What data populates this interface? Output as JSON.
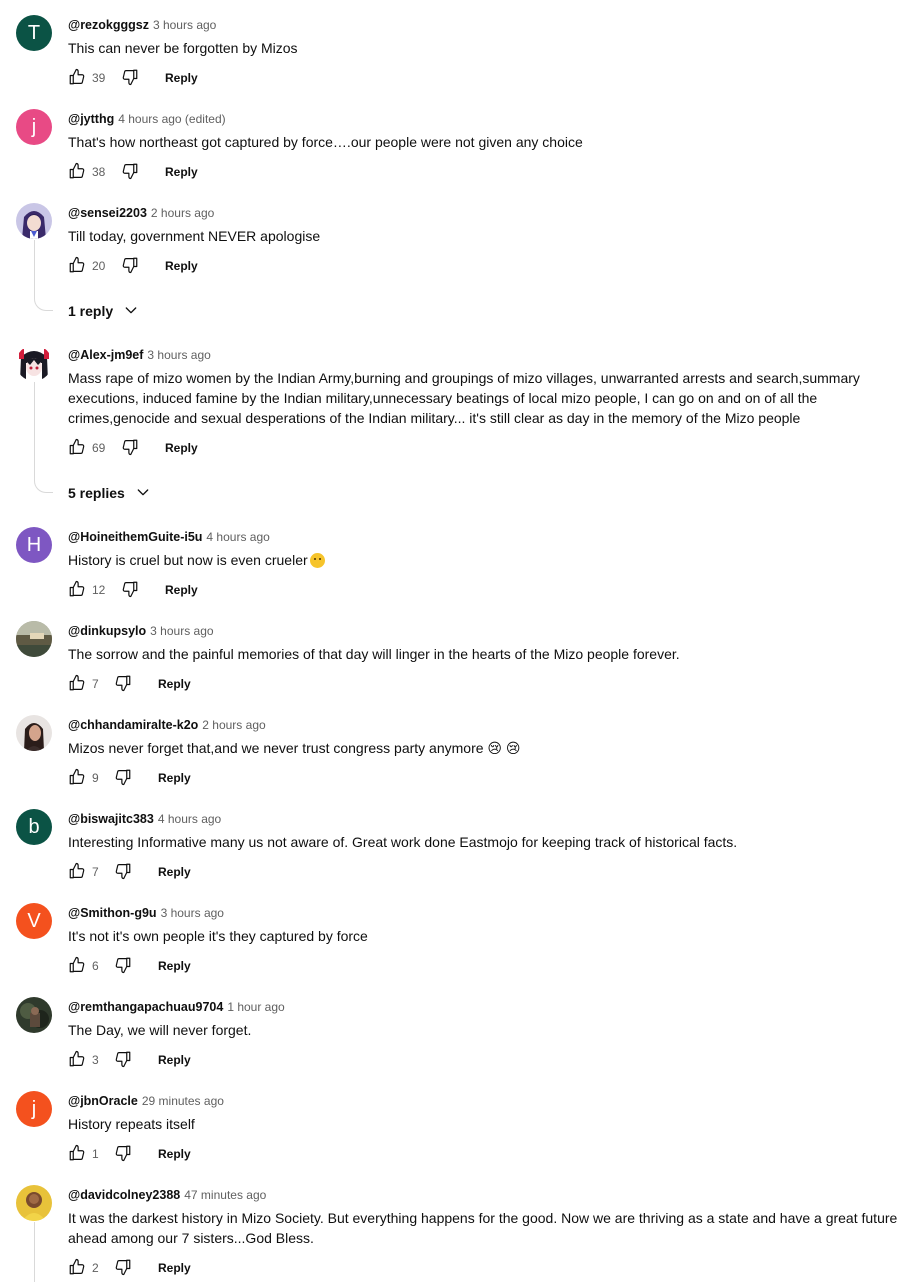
{
  "comments": [
    {
      "author": "@rezokgggsz",
      "time": "3 hours ago",
      "text": "This can never be forgotten by Mizos",
      "likes": "39",
      "reply_label": "Reply",
      "avatar_letter": "T",
      "avatar_color": "#0b5345"
    },
    {
      "author": "@jytthg",
      "time": "4 hours ago (edited)",
      "text": "That's how northeast got captured by force….our people were not given any choice",
      "likes": "38",
      "reply_label": "Reply",
      "avatar_letter": "j",
      "avatar_color": "#e84a85"
    },
    {
      "author": "@sensei2203",
      "time": "2 hours ago",
      "text": "Till today, government NEVER apologise",
      "likes": "20",
      "reply_label": "Reply",
      "replies_label": "1 reply"
    },
    {
      "author": "@Alex-jm9ef",
      "time": "3 hours ago",
      "text": "Mass rape of mizo women by the Indian Army,burning and groupings of mizo villages, unwarranted arrests and search,summary executions, induced famine by the Indian military,unnecessary beatings of local mizo people, I can go on and on of all the crimes,genocide and sexual desperations of the Indian military... it's still clear as day in the memory of the Mizo people",
      "likes": "69",
      "reply_label": "Reply",
      "replies_label": "5 replies"
    },
    {
      "author": "@HoineithemGuite-i5u",
      "time": "4 hours ago",
      "text": "History is cruel but now is even crueler",
      "likes": "12",
      "reply_label": "Reply",
      "avatar_letter": "H",
      "avatar_color": "#7e57c2"
    },
    {
      "author": "@dinkupsylo",
      "time": "3 hours ago",
      "text": "The sorrow and the painful memories of that day will linger in the hearts of the Mizo people forever.",
      "likes": "7",
      "reply_label": "Reply"
    },
    {
      "author": "@chhandamiralte-k2o",
      "time": "2 hours ago",
      "text": "Mizos never forget that,and we never trust congress party anymore 😢 😢",
      "likes": "9",
      "reply_label": "Reply"
    },
    {
      "author": "@biswajitc383",
      "time": "4 hours ago",
      "text": "Interesting Informative many us not aware of. Great work done Eastmojo for keeping track of historical facts.",
      "likes": "7",
      "reply_label": "Reply",
      "avatar_letter": "b",
      "avatar_color": "#0b5345"
    },
    {
      "author": "@Smithon-g9u",
      "time": "3 hours ago",
      "text": "It's not it's own people it's they captured by force",
      "likes": "6",
      "reply_label": "Reply",
      "avatar_letter": "V",
      "avatar_color": "#f4511e"
    },
    {
      "author": "@remthangapachuau9704",
      "time": "1 hour ago",
      "text": "The Day, we will never forget.",
      "likes": "3",
      "reply_label": "Reply"
    },
    {
      "author": "@jbnOracle",
      "time": "29 minutes ago",
      "text": "History repeats itself",
      "likes": "1",
      "reply_label": "Reply",
      "avatar_letter": "j",
      "avatar_color": "#f4511e"
    },
    {
      "author": "@davidcolney2388",
      "time": "47 minutes ago",
      "text": "It was the darkest history in Mizo Society. But everything happens for the good. Now we are thriving as a state and have a great future ahead among our 7 sisters...God Bless.",
      "likes": "2",
      "reply_label": "Reply"
    }
  ],
  "icons": {
    "like": "thumbs-up-icon",
    "dislike": "thumbs-down-icon",
    "expand": "chevron-down-icon"
  },
  "colors": {
    "text_primary": "#0f0f0f",
    "text_secondary": "#606060",
    "thread_line": "#d9d9d9"
  }
}
